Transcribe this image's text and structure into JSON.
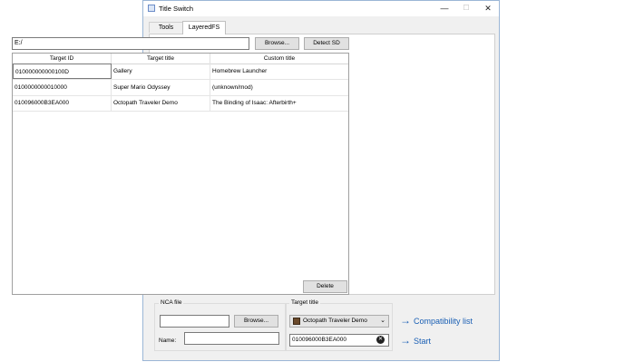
{
  "window": {
    "title": "Title Switch"
  },
  "tabs": [
    {
      "label": "Tools"
    },
    {
      "label": "LayeredFS"
    }
  ],
  "path": {
    "value": "E:/"
  },
  "buttons": {
    "browse": "Browse...",
    "detect_sd": "Detect SD",
    "delete": "Delete"
  },
  "table": {
    "columns": [
      "Target ID",
      "Target title",
      "Custom title"
    ],
    "rows": [
      [
        "010000000000100D",
        "Gallery",
        "Homebrew Launcher"
      ],
      [
        "0100000000010000",
        "Super Mario Odyssey",
        "(unknown/mod)"
      ],
      [
        "010096000B3EA000",
        "Octopath Traveler Demo",
        "The Binding of Isaac: Afterbirth+"
      ]
    ]
  },
  "nca": {
    "label": "NCA file",
    "value": "",
    "browse": "Browse...",
    "name_label": "Name:",
    "name_value": ""
  },
  "target": {
    "label": "Target title",
    "selected": "Octopath Traveler Demo",
    "id_value": "010096000B3EA000"
  },
  "actions": {
    "compat": "Compatibility list",
    "start": "Start"
  }
}
